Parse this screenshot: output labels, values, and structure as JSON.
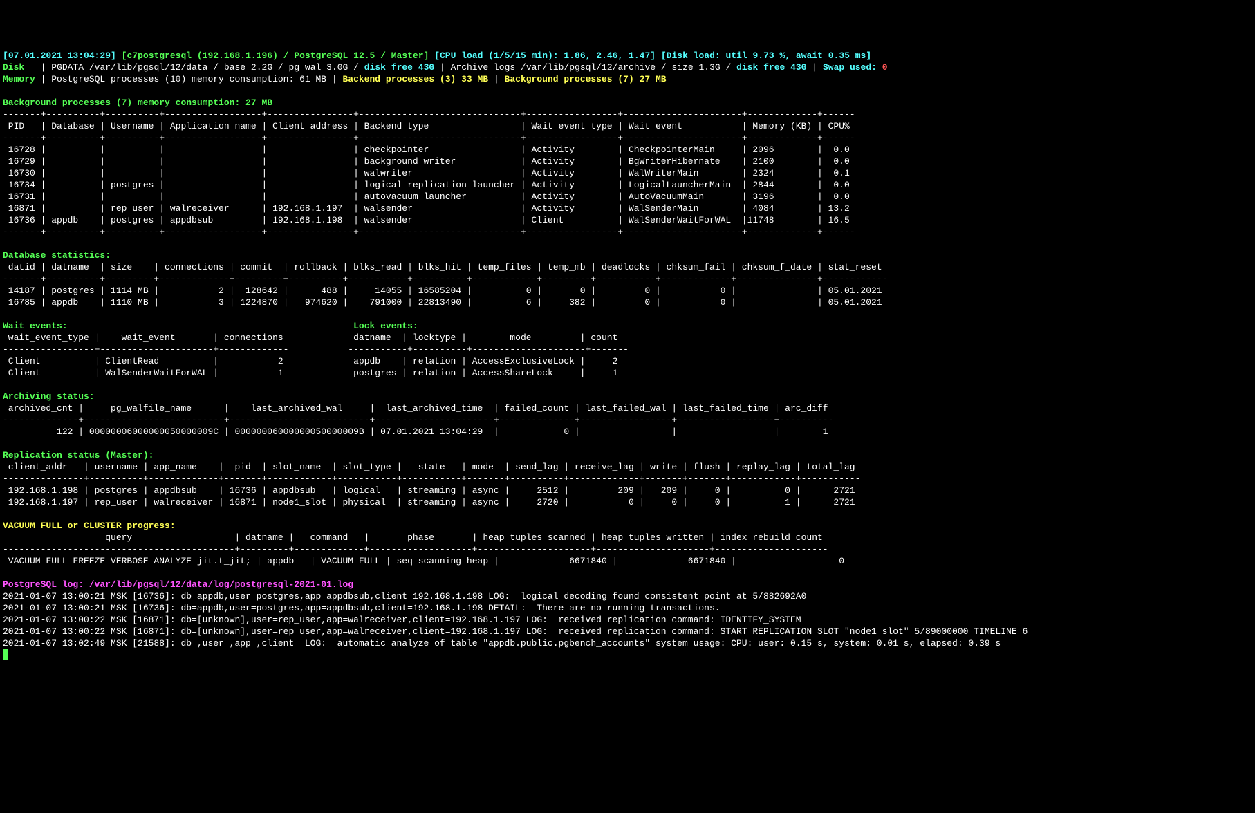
{
  "header": {
    "timestamp": "07.01.2021 13:04:29",
    "host": "c7postgresql (192.168.1.196) / PostgreSQL 12.5 / Master",
    "cpu": "CPU load (1/5/15 min): 1.86, 2.46, 1.47",
    "disk": "Disk load: util 9.73 %, await 0.35 ms",
    "disk_line": {
      "label": "Disk",
      "pgdata_label": "PGDATA",
      "pgdata_path": "/var/lib/pgsql/12/data",
      "base": "base 2.2G",
      "pg_wal": "pg_wal 3.0G",
      "disk_free": "disk free 43G",
      "arch_label": "Archive logs",
      "arch_path": "/var/lib/pgsql/12/archive",
      "arch_size": "size 1.3G",
      "arch_free": "disk free 43G",
      "swap_label": "Swap used:",
      "swap_value": "0"
    },
    "mem_line": {
      "label": "Memory",
      "pg_procs": "PostgreSQL processes (10) memory consumption: 61 MB",
      "backend": "Backend processes (3) 33 MB",
      "background": "Background processes (7) 27 MB"
    }
  },
  "bg_title": "Background processes (7) memory consumption: 27 MB",
  "bg_cols": " PID   | Database | Username | Application name | Client address | Backend type                 | Wait event type | Wait event           | Memory (KB) | CPU%",
  "bg_sep1": "-------+----------+----------+------------------+----------------+------------------------------+-----------------+----------------------+-------------+------",
  "bg_sep2": "-------+----------+----------+------------------+----------------+------------------------------+-----------------+----------------------+-------------+------",
  "bg_rows": {
    "r0": " 16728 |          |          |                  |                | checkpointer                 | Activity        | CheckpointerMain     | 2096        |  0.0",
    "r1": " 16729 |          |          |                  |                | background writer            | Activity        | BgWriterHibernate    | 2100        |  0.0",
    "r2": " 16730 |          |          |                  |                | walwriter                    | Activity        | WalWriterMain        | 2324        |  0.1",
    "r3": " 16734 |          | postgres |                  |                | logical replication launcher | Activity        | LogicalLauncherMain  | 2844        |  0.0",
    "r4": " 16731 |          |          |                  |                | autovacuum launcher          | Activity        | AutoVacuumMain       | 3196        |  0.0",
    "r5": " 16871 |          | rep_user | walreceiver      | 192.168.1.197  | walsender                    | Activity        | WalSenderMain        | 4084        | 13.2",
    "r6": " 16736 | appdb    | postgres | appdbsub         | 192.168.1.198  | walsender                    | Client          | WalSenderWaitForWAL  |11748        | 16.5"
  },
  "db_title": "Database statistics:",
  "db_cols": " datid | datname  | size    | connections | commit  | rollback | blks_read | blks_hit | temp_files | temp_mb | deadlocks | chksum_fail | chksum_f_date | stat_reset",
  "db_sep": "-------+----------+---------+-------------+---------+----------+-----------+----------+------------+---------+-----------+-------------+---------------+------------",
  "db_rows": {
    "r0": " 14187 | postgres | 1114 MB |           2 |  128642 |      488 |     14055 | 16585204 |          0 |       0 |         0 |           0 |               | 05.01.2021",
    "r1": " 16785 | appdb    | 1110 MB |           3 | 1224870 |   974620 |    791000 | 22813490 |          6 |     382 |         0 |           0 |               | 05.01.2021"
  },
  "wait_title": "Wait events:",
  "lock_title": "Lock events:",
  "wait_cols": " wait_event_type |    wait_event       | connections",
  "lock_cols": "  datname  | locktype |        mode         | count",
  "wait_sep": "-----------------+---------------------+-------------",
  "lock_sep": "-----------+----------+---------------------+-------",
  "wait_rows": {
    "r0": " Client          | ClientRead          |           2",
    "r1": " Client          | WalSenderWaitForWAL |           1"
  },
  "lock_rows": {
    "r0": "  appdb    | relation | AccessExclusiveLock |     2",
    "r1": "  postgres | relation | AccessShareLock     |     1"
  },
  "arch_title": "Archiving status:",
  "arch_cols": " archived_cnt |     pg_walfile_name      |    last_archived_wal     |  last_archived_time  | failed_count | last_failed_wal | last_failed_time | arc_diff",
  "arch_sep": "--------------+--------------------------+--------------------------+----------------------+--------------+-----------------+------------------+----------",
  "arch_row": "          122 | 00000006000000050000009C | 00000006000000050000009B | 07.01.2021 13:04:29  |            0 |                 |                  |        1",
  "repl_title": "Replication status (Master):",
  "repl_cols": " client_addr   | username | app_name    |  pid  | slot_name  | slot_type |   state   | mode  | send_lag | receive_lag | write | flush | replay_lag | total_lag",
  "repl_sep": "---------------+----------+-------------+-------+------------+-----------+-----------+-------+----------+-------------+-------+-------+------------+-----------",
  "repl_rows": {
    "r0": " 192.168.1.198 | postgres | appdbsub    | 16736 | appdbsub   | logical   | streaming | async |     2512 |         209 |   209 |     0 |          0 |      2721",
    "r1": " 192.168.1.197 | rep_user | walreceiver | 16871 | node1_slot | physical  | streaming | async |     2720 |           0 |     0 |     0 |          1 |      2721"
  },
  "vac_title": "VACUUM FULL or CLUSTER progress:",
  "vac_cols": "                   query                   | datname |   command   |       phase       | heap_tuples_scanned | heap_tuples_written | index_rebuild_count",
  "vac_sep": "-------------------------------------------+---------+-------------+-------------------+---------------------+---------------------+---------------------",
  "vac_row": " VACUUM FULL FREEZE VERBOSE ANALYZE jit.t_jit; | appdb   | VACUUM FULL | seq scanning heap |             6671840 |             6671840 |                   0",
  "log_title": "PostgreSQL log: ",
  "log_path": "/var/lib/pgsql/12/data/log/postgresql-2021-01.log",
  "log_lines": {
    "l0": "2021-01-07 13:00:21 MSK [16736]: db=appdb,user=postgres,app=appdbsub,client=192.168.1.198 LOG:  logical decoding found consistent point at 5/882692A0",
    "l1": "2021-01-07 13:00:21 MSK [16736]: db=appdb,user=postgres,app=appdbsub,client=192.168.1.198 DETAIL:  There are no running transactions.",
    "l2": "2021-01-07 13:00:22 MSK [16871]: db=[unknown],user=rep_user,app=walreceiver,client=192.168.1.197 LOG:  received replication command: IDENTIFY_SYSTEM",
    "l3": "2021-01-07 13:00:22 MSK [16871]: db=[unknown],user=rep_user,app=walreceiver,client=192.168.1.197 LOG:  received replication command: START_REPLICATION SLOT \"node1_slot\" 5/89000000 TIMELINE 6",
    "l4": "2021-01-07 13:02:49 MSK [21588]: db=,user=,app=,client= LOG:  automatic analyze of table \"appdb.public.pgbench_accounts\" system usage: CPU: user: 0.15 s, system: 0.01 s, elapsed: 0.39 s"
  }
}
